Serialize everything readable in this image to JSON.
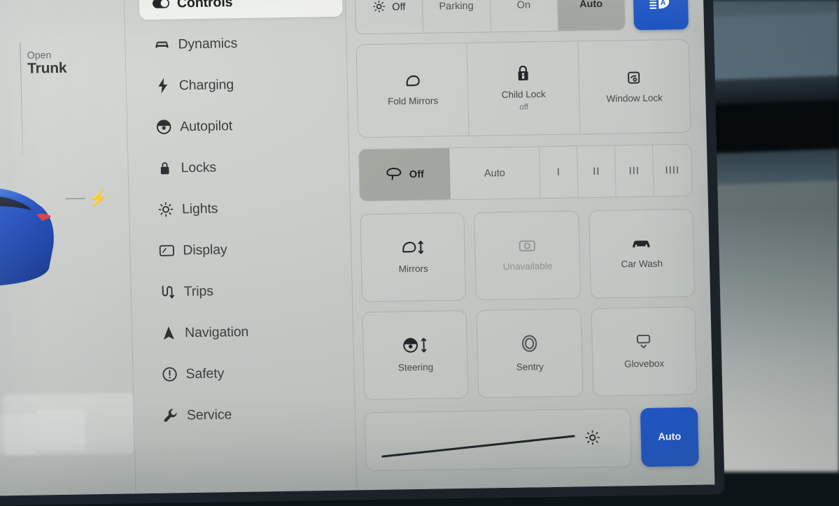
{
  "colors": {
    "accent_blue": "#1f56c4",
    "panel_grey": "#c8cbc8",
    "selected_grey": "#96998f",
    "text_dark": "#1b1f21",
    "text_muted": "#6a7073"
  },
  "left_panel": {
    "action_verb": "Open",
    "action_target": "Trunk",
    "charge_port_icon": "lightning-bolt-icon",
    "vehicle_image": "blue-model-3-rear-three-quarter"
  },
  "sidebar": {
    "items": [
      {
        "label": "Controls",
        "icon": "toggle-switch-icon",
        "active": true
      },
      {
        "label": "Dynamics",
        "icon": "car-front-icon",
        "active": false
      },
      {
        "label": "Charging",
        "icon": "lightning-bolt-icon",
        "active": false
      },
      {
        "label": "Autopilot",
        "icon": "steering-wheel-icon",
        "active": false
      },
      {
        "label": "Locks",
        "icon": "padlock-icon",
        "active": false
      },
      {
        "label": "Lights",
        "icon": "sun-brightness-icon",
        "active": false
      },
      {
        "label": "Display",
        "icon": "screen-icon",
        "active": false
      },
      {
        "label": "Trips",
        "icon": "route-icon",
        "active": false
      },
      {
        "label": "Navigation",
        "icon": "navigation-arrow-icon",
        "active": false
      },
      {
        "label": "Safety",
        "icon": "exclamation-circle-icon",
        "active": false
      },
      {
        "label": "Service",
        "icon": "wrench-icon",
        "active": false
      }
    ]
  },
  "headlights": {
    "icon": "headlight-sun-icon",
    "options": [
      {
        "label": "Off",
        "selected": false,
        "has_icon": true
      },
      {
        "label": "Parking",
        "selected": false,
        "has_icon": false
      },
      {
        "label": "On",
        "selected": false,
        "has_icon": false
      },
      {
        "label": "Auto",
        "selected": true,
        "has_icon": false
      }
    ],
    "high_beam_button": {
      "icon": "auto-high-beam-icon",
      "active": true
    }
  },
  "mirror_lock_row": {
    "tiles": [
      {
        "label": "Fold Mirrors",
        "sub": "",
        "icon": "mirror-icon",
        "disabled": false
      },
      {
        "label": "Child Lock",
        "sub": "off",
        "icon": "child-lock-icon",
        "disabled": false
      },
      {
        "label": "Window Lock",
        "sub": "",
        "icon": "window-lock-icon",
        "disabled": false
      }
    ]
  },
  "wipers": {
    "icon": "wiper-icon",
    "options": [
      {
        "label": "Off",
        "selected": true,
        "has_icon": true,
        "narrow": false
      },
      {
        "label": "Auto",
        "selected": false,
        "has_icon": false,
        "narrow": false
      },
      {
        "label": "I",
        "selected": false,
        "has_icon": false,
        "narrow": true
      },
      {
        "label": "II",
        "selected": false,
        "has_icon": false,
        "narrow": true
      },
      {
        "label": "III",
        "selected": false,
        "has_icon": false,
        "narrow": true
      },
      {
        "label": "IIII",
        "selected": false,
        "has_icon": false,
        "narrow": true
      }
    ]
  },
  "quick_cards": [
    {
      "label": "Mirrors",
      "icon": "mirror-adjust-icon",
      "disabled": false
    },
    {
      "label": "Unavailable",
      "icon": "camera-icon",
      "disabled": true
    },
    {
      "label": "Car Wash",
      "icon": "car-wash-icon",
      "disabled": false
    },
    {
      "label": "Steering",
      "icon": "steering-adjust-icon",
      "disabled": false
    },
    {
      "label": "Sentry",
      "icon": "sentry-lens-icon",
      "disabled": false
    },
    {
      "label": "Glovebox",
      "icon": "glovebox-icon",
      "disabled": false
    }
  ],
  "brightness": {
    "slider_icon": "sun-brightness-icon",
    "auto_label": "Auto",
    "auto_active": true
  }
}
